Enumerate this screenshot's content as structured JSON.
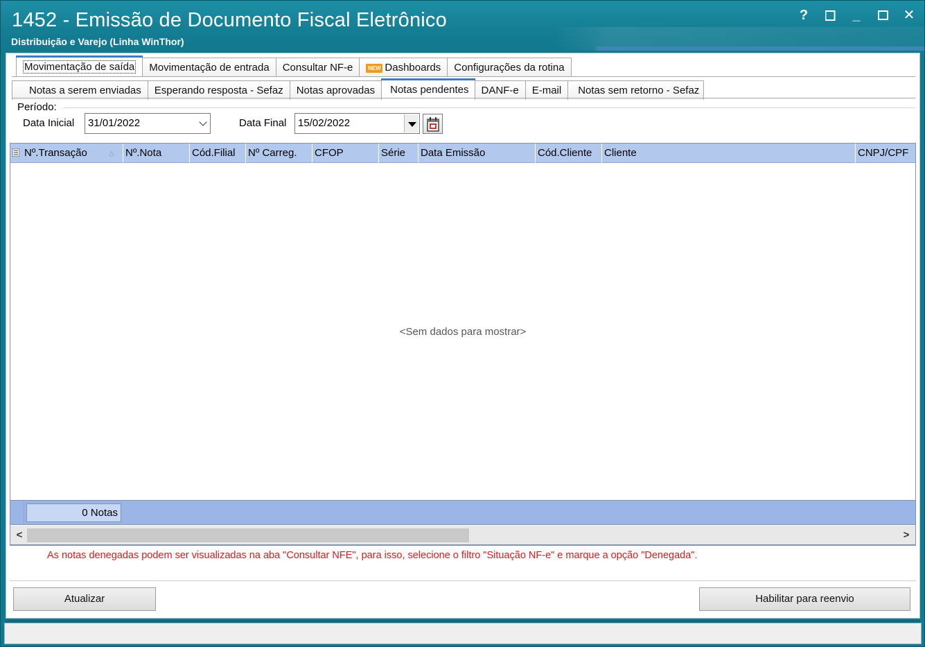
{
  "window": {
    "title": "1452 - Emissão de Documento Fiscal Eletrônico",
    "subtitle": "Distribuição e Varejo (Linha WinThor)",
    "controls": [
      "?",
      "_",
      "✕"
    ]
  },
  "tabs_main": [
    {
      "label": "Movimentação de saída",
      "active": true
    },
    {
      "label": "Movimentação de entrada"
    },
    {
      "label": "Consultar NF-e"
    },
    {
      "label": "Dashboards",
      "badge": "NEW"
    },
    {
      "label": "Configurações da rotina"
    }
  ],
  "tabs_sub": [
    {
      "label": "Notas a serem enviadas"
    },
    {
      "label": "Esperando resposta - Sefaz"
    },
    {
      "label": "Notas aprovadas"
    },
    {
      "label": "Notas pendentes",
      "active": true
    },
    {
      "label": "DANF-e"
    },
    {
      "label": "E-mail"
    },
    {
      "label": "Notas sem retorno - Sefaz"
    }
  ],
  "filter": {
    "group_label": "Período:",
    "data_inicial_label": "Data Inicial",
    "data_inicial_value": "31/01/2022",
    "data_final_label": "Data Final",
    "data_final_value": "15/02/2022"
  },
  "grid": {
    "columns": [
      "Nº.Transação",
      "Nº.Nota",
      "Cód.Filial",
      "Nº Carreg.",
      "CFOP",
      "Série",
      "Data Emissão",
      "Cód.Cliente",
      "Cliente",
      "CNPJ/CPF"
    ],
    "sort_indicator": "△",
    "empty_message": "<Sem dados para mostrar>",
    "footer_count": "0 Notas"
  },
  "scroll": {
    "left": "<",
    "right": ">"
  },
  "note": "As notas denegadas podem ser visualizadas na aba \"Consultar NFE\", para isso, selecione o filtro \"Situação NF-e\" e marque a opção \"Denegada\".",
  "buttons": {
    "atualizar": "Atualizar",
    "reenvio": "Habilitar para reenvio"
  },
  "colors": {
    "titlebar": "#157f95",
    "grid_header": "#b2c8ec",
    "footer": "#9bb5e6",
    "note": "#e8161b",
    "active_tab_accent": "#3b7dc3"
  }
}
